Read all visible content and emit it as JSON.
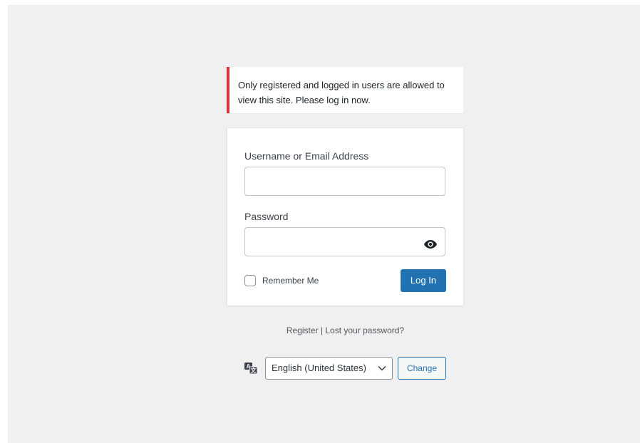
{
  "notice": {
    "message": "Only registered and logged in users are allowed to view this site. Please log in now."
  },
  "login_form": {
    "username_label": "Username or Email Address",
    "username_value": "",
    "password_label": "Password",
    "password_value": "",
    "show_password_icon": "eye-icon",
    "remember_label": "Remember Me",
    "remember_checked": false,
    "submit_label": "Log In"
  },
  "nav": {
    "register_label": "Register",
    "separator": "|",
    "lost_password_label": "Lost your password?"
  },
  "language": {
    "icon": "translation-icon",
    "selected": "English (United States)",
    "change_label": "Change"
  },
  "colors": {
    "background": "#f0f0f1",
    "error_accent": "#d63638",
    "primary": "#2271b1"
  }
}
